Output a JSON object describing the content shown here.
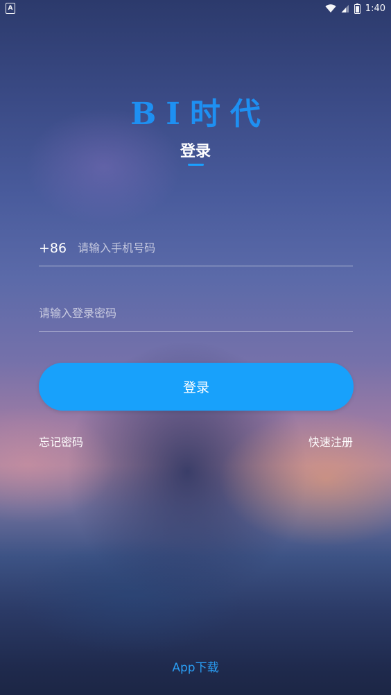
{
  "status_bar": {
    "left_icon_letter": "A",
    "time": "1:40"
  },
  "logo": {
    "text": "BI时代",
    "color": "#1e90f2"
  },
  "tab": {
    "title": "登录",
    "underline_color": "#1aa0ff"
  },
  "form": {
    "country_code": "+86",
    "phone_placeholder": "请输入手机号码",
    "phone_value": "",
    "password_placeholder": "请输入登录密码",
    "password_value": ""
  },
  "login_button": {
    "label": "登录",
    "color": "#18a1fb"
  },
  "links": {
    "forgot_password": "忘记密码",
    "quick_register": "快速注册"
  },
  "footer": {
    "app_download": "App下载"
  }
}
